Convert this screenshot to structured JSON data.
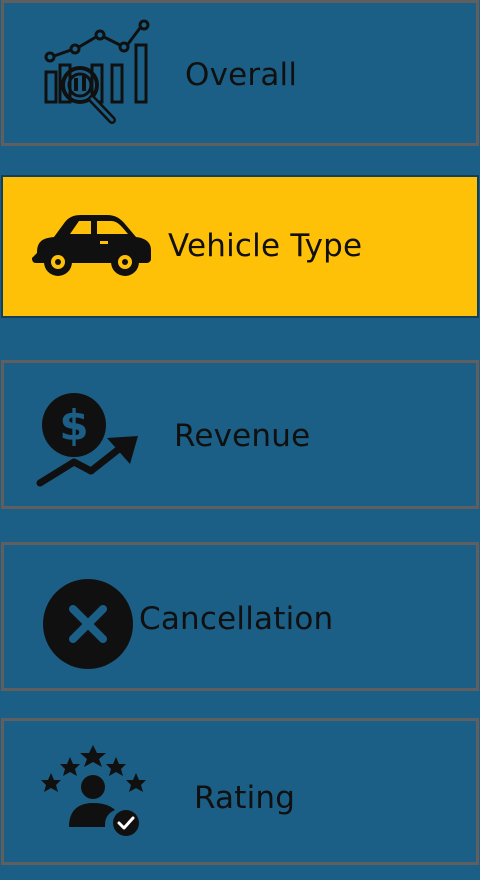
{
  "nav": {
    "items": [
      {
        "label": "Overall",
        "icon": "analytics-icon"
      },
      {
        "label": "Vehicle Type",
        "icon": "car-icon",
        "active": true
      },
      {
        "label": "Revenue",
        "icon": "revenue-icon"
      },
      {
        "label": "Cancellation",
        "icon": "cancel-icon"
      },
      {
        "label": "Rating",
        "icon": "rating-icon"
      }
    ]
  },
  "colors": {
    "background": "#1b5f86",
    "active": "#ffc107",
    "border": "#5f5f5f",
    "text": "#101010"
  }
}
